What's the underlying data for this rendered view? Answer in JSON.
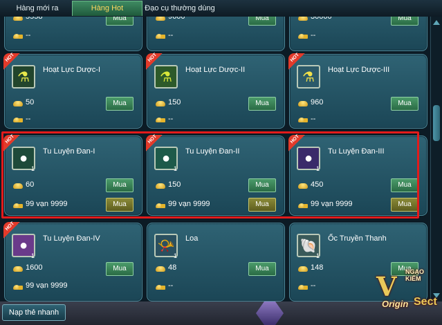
{
  "tabs": [
    {
      "label": "Hàng mới ra"
    },
    {
      "label": "Hàng Hot"
    },
    {
      "label": "Đạo cụ thường dùng"
    }
  ],
  "top_partial": [
    {
      "price": "5558",
      "price2": "--",
      "buy": "Mua"
    },
    {
      "price": "9600",
      "price2": "--",
      "buy": "Mua"
    },
    {
      "price": "30000",
      "price2": "--",
      "buy": "Mua"
    }
  ],
  "items": [
    {
      "name": "Hoạt Lực Dược-I",
      "qty": "",
      "hot": "HOT",
      "price": "50",
      "price2": "--",
      "buy": "Mua",
      "buy2": ""
    },
    {
      "name": "Hoạt Lực Dược-II",
      "qty": "",
      "hot": "HOT",
      "price": "150",
      "price2": "--",
      "buy": "Mua",
      "buy2": ""
    },
    {
      "name": "Hoạt Lực Dược-III",
      "qty": "",
      "hot": "HOT",
      "price": "960",
      "price2": "--",
      "buy": "Mua",
      "buy2": ""
    },
    {
      "name": "Tu Luyện Đan-I",
      "qty": "1",
      "hot": "HOT",
      "price": "60",
      "price2": "99 vạn 9999",
      "buy": "Mua",
      "buy2": "Mua"
    },
    {
      "name": "Tu Luyện Đan-II",
      "qty": "1",
      "hot": "HOT",
      "price": "150",
      "price2": "99 vạn 9999",
      "buy": "Mua",
      "buy2": "Mua"
    },
    {
      "name": "Tu Luyện Đan-III",
      "qty": "1",
      "hot": "HOT",
      "price": "450",
      "price2": "99 vạn 9999",
      "buy": "Mua",
      "buy2": "Mua"
    },
    {
      "name": "Tu Luyện Đan-IV",
      "qty": "1",
      "hot": "HOT",
      "price": "1600",
      "price2": "99 vạn 9999",
      "buy": "Mua",
      "buy2": ""
    },
    {
      "name": "Loa",
      "qty": "1",
      "hot": "",
      "price": "48",
      "price2": "--",
      "buy": "Mua",
      "buy2": ""
    },
    {
      "name": "Ốc Truyền Thanh",
      "qty": "1",
      "hot": "",
      "price": "148",
      "price2": "--",
      "buy": "Mua",
      "buy2": ""
    }
  ],
  "footer": {
    "recharge": "Nạp thẻ nhanh"
  },
  "logo": {
    "main": "V",
    "small": "NGẠO KIẾM",
    "origin": "Origin",
    "secret": "Sect"
  },
  "colors": {
    "selection": "#e21b1b",
    "hot": "#e23a2a",
    "buy": "#3c8657",
    "buy_gold": "#7a7a2a"
  }
}
